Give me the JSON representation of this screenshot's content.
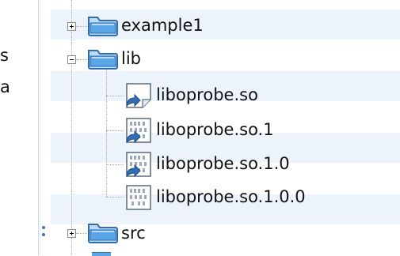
{
  "colors": {
    "zebra_row": "#edf3fb",
    "folder_fill": "#5aa5e6",
    "folder_stroke": "#2f6db5",
    "separator": "#c9d7ea",
    "scroll_dot": "#3c78c0"
  },
  "left_pane": {
    "clipped_text": [
      "s",
      "a"
    ]
  },
  "tree": {
    "items": [
      {
        "label": "example1",
        "type": "folder",
        "expanded": false,
        "icon": "folder-icon"
      },
      {
        "label": "lib",
        "type": "folder",
        "expanded": true,
        "icon": "folder-open-icon",
        "children": [
          {
            "label": "liboprobe.so",
            "type": "symlink",
            "icon": "symlink-file-icon"
          },
          {
            "label": "liboprobe.so.1",
            "type": "symlink",
            "icon": "symlink-binary-icon"
          },
          {
            "label": "liboprobe.so.1.0",
            "type": "symlink",
            "icon": "symlink-binary-icon"
          },
          {
            "label": "liboprobe.so.1.0.0",
            "type": "file",
            "icon": "binary-file-icon"
          }
        ]
      },
      {
        "label": "src",
        "type": "folder",
        "expanded": false,
        "icon": "folder-icon"
      }
    ]
  }
}
